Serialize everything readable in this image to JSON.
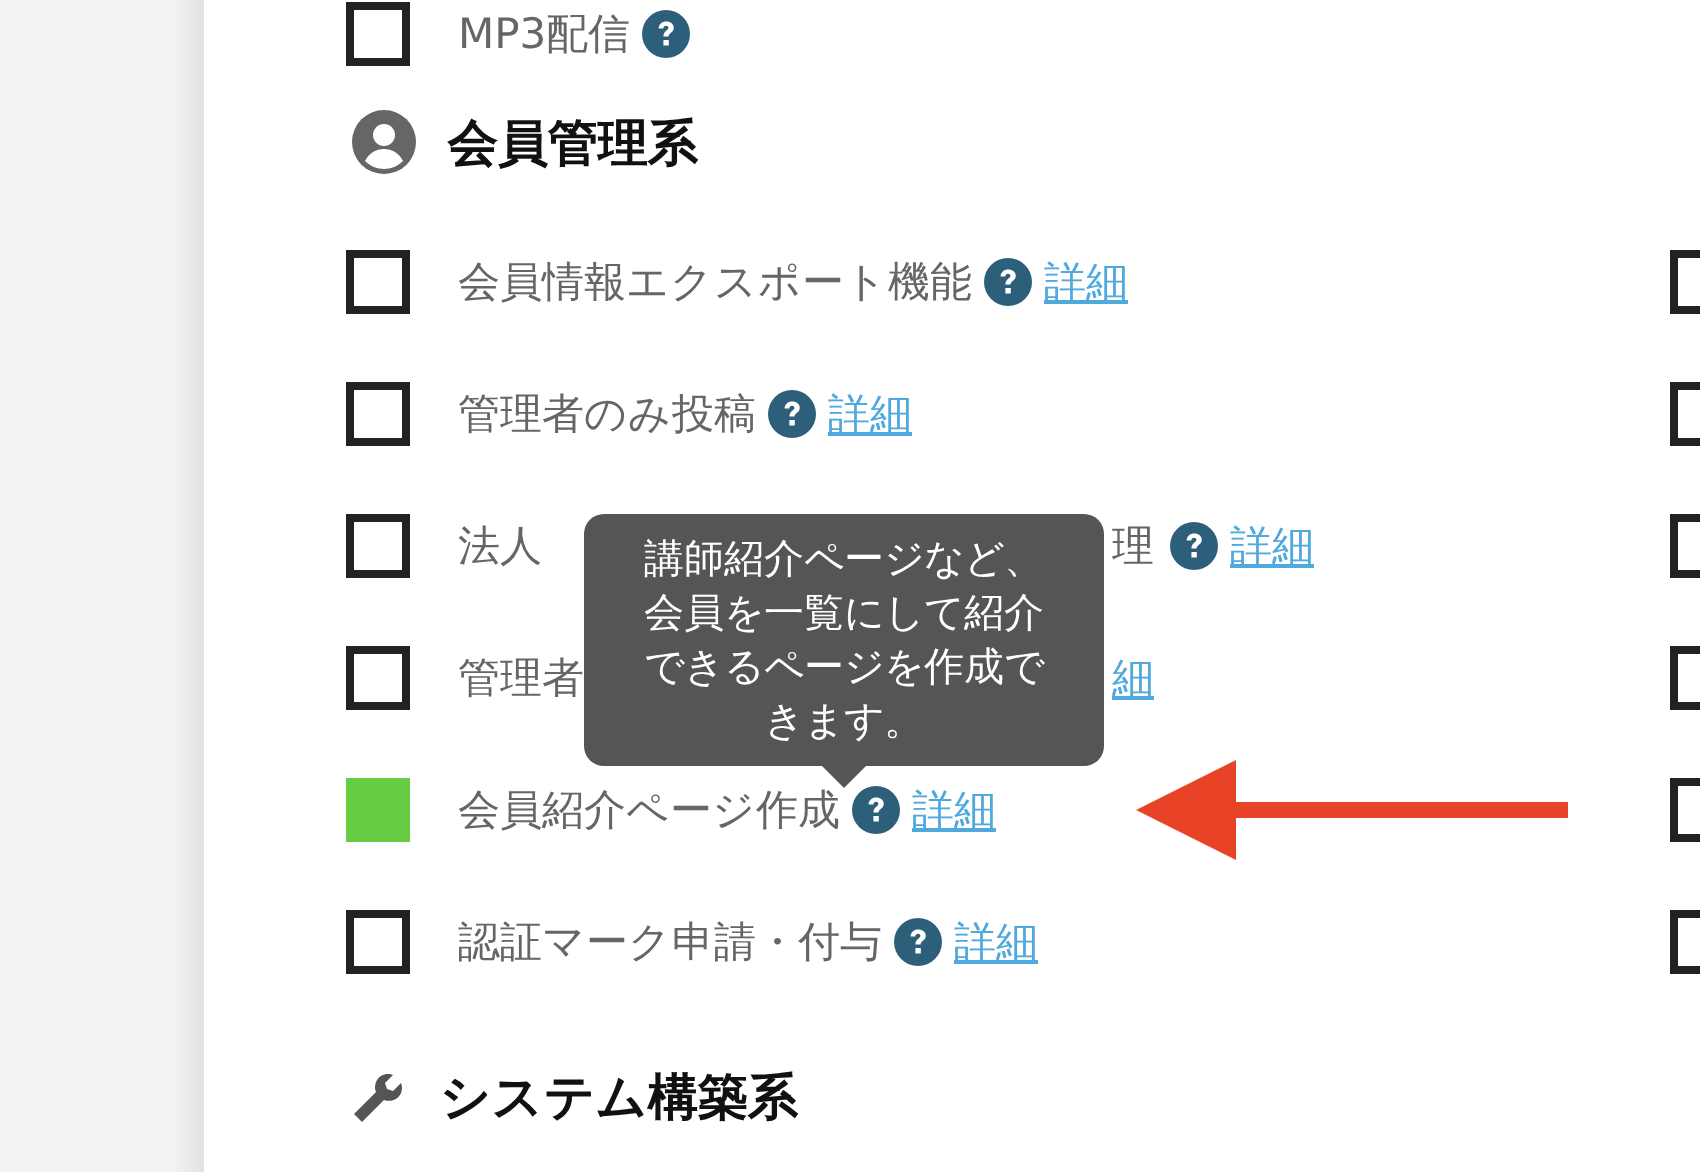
{
  "top_item": {
    "label": "MP3配信",
    "checked": false,
    "help": true
  },
  "section": {
    "title": "会員管理系"
  },
  "items": [
    {
      "label": "会員情報エクスポート機能",
      "checked": false,
      "help": true,
      "link": "詳細"
    },
    {
      "label": "管理者のみ投稿",
      "checked": false,
      "help": true,
      "link": "詳細"
    },
    {
      "label": "法人",
      "label_tail": "理",
      "checked": false,
      "help": true,
      "link": "詳細"
    },
    {
      "label": "管理者",
      "checked": false,
      "help": false,
      "link": "細"
    },
    {
      "label": "会員紹介ページ作成",
      "checked": true,
      "help": true,
      "link": "詳細"
    },
    {
      "label": "認証マーク申請・付与",
      "checked": false,
      "help": true,
      "link": "詳細"
    }
  ],
  "right_column": [
    {
      "checked": false
    },
    {
      "checked": false
    },
    {
      "checked": false
    },
    {
      "checked": false
    },
    {
      "checked": false
    },
    {
      "checked": false
    }
  ],
  "tooltip": {
    "text": "講師紹介ページなど、会員を一覧にして紹介できるページを作成できます。"
  },
  "next_section": {
    "title": "システム構築系"
  }
}
